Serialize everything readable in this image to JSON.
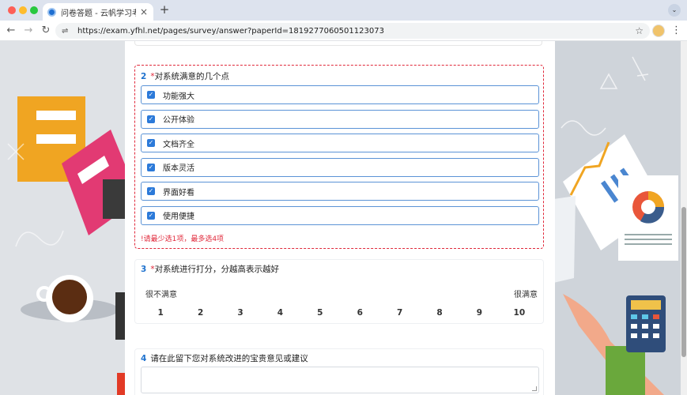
{
  "browser": {
    "tab_title": "问卷答题 - 云帆学习考试系统",
    "tab_close": "×",
    "new_tab": "+",
    "tab_menu": "⌄",
    "back": "←",
    "forward": "→",
    "reload": "↻",
    "site_info": "⇌",
    "url": "https://exam.yfhl.net/pages/survey/answer?paperId=1819277060501123073",
    "bookmark": "☆",
    "menu": "⋮"
  },
  "questions": [
    {
      "number": "2",
      "required_mark": "*",
      "title": "对系统满意的几个点",
      "options": [
        {
          "label": "功能强大",
          "checked": true
        },
        {
          "label": "公开体验",
          "checked": true
        },
        {
          "label": "文档齐全",
          "checked": true
        },
        {
          "label": "版本灵活",
          "checked": true
        },
        {
          "label": "界面好看",
          "checked": true
        },
        {
          "label": "使用便捷",
          "checked": true
        }
      ],
      "error": "!请最少选1项，最多选4项",
      "check_glyph": "✓"
    },
    {
      "number": "3",
      "required_mark": "*",
      "title": "对系统进行打分，分越高表示越好",
      "scale_min_label": "很不满意",
      "scale_max_label": "很满意",
      "scale": [
        "1",
        "2",
        "3",
        "4",
        "5",
        "6",
        "7",
        "8",
        "9",
        "10"
      ]
    },
    {
      "number": "4",
      "required_mark": "",
      "title": "请在此留下您对系统改进的宝贵意见或建议",
      "answer": ""
    }
  ],
  "colors": {
    "accent": "#2c7ad9",
    "error": "#e0283a",
    "question_number": "#1f72ce"
  }
}
